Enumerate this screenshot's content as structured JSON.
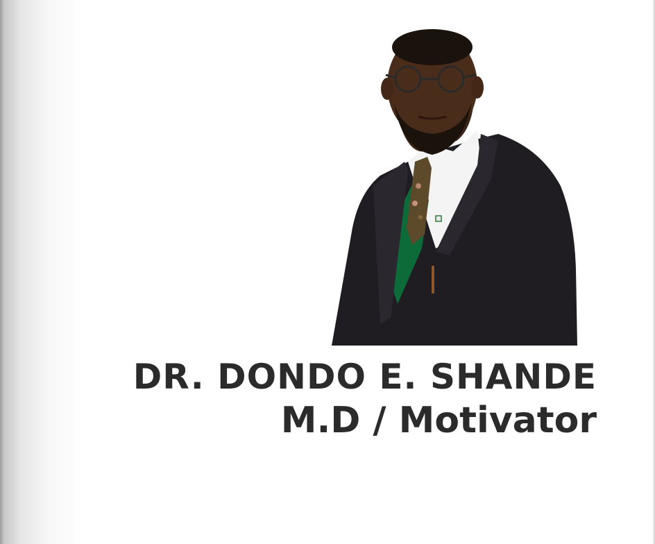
{
  "profile": {
    "name": "DR. DONDO E. SHANDE",
    "title": "M.D / Motivator"
  },
  "colors": {
    "text": "#2b2b2b",
    "background": "#ffffff",
    "suit": "#1f1d22",
    "shirt": "#ffffff",
    "vest_green": "#0d6b3a"
  }
}
